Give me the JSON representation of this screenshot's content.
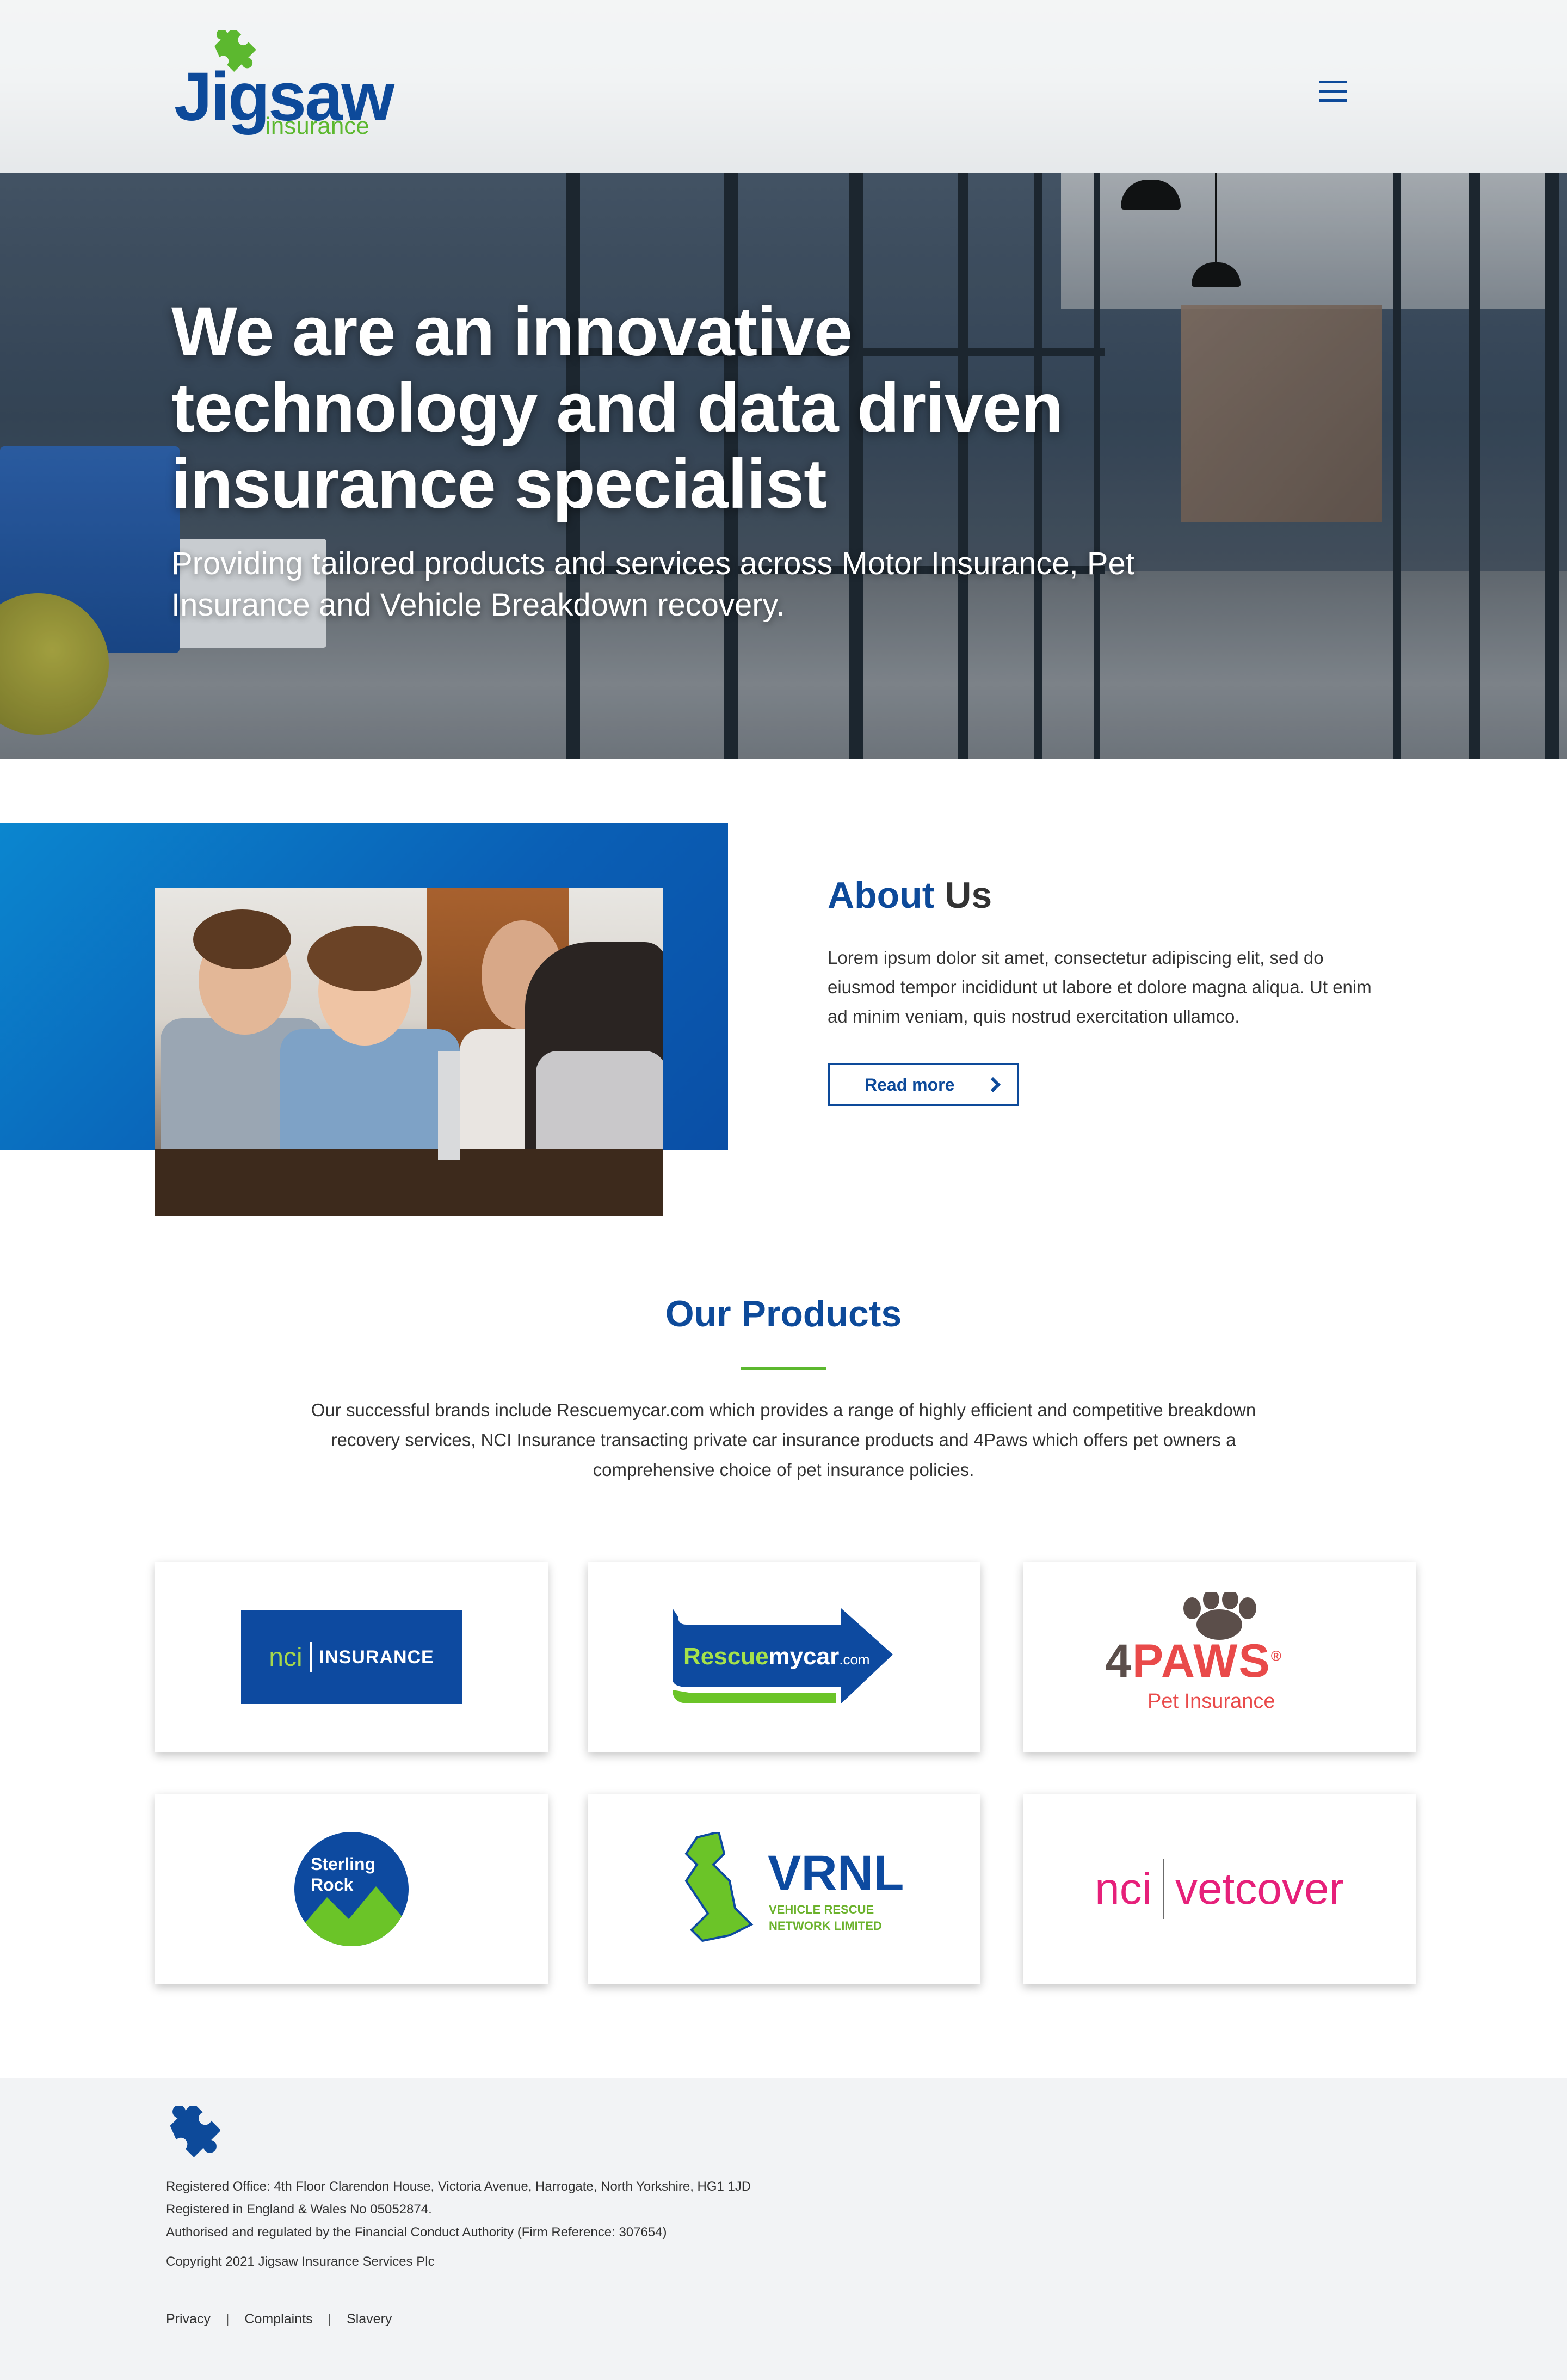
{
  "header": {
    "logo_word": "Jigsaw",
    "logo_sub": "insurance"
  },
  "hero": {
    "title": "We are an innovative technology and data driven insurance specialist",
    "subtitle": "Providing tailored products and services across Motor Insurance, Pet Insurance and Vehicle Breakdown recovery."
  },
  "about": {
    "title_highlight": "About",
    "title_rest": " Us",
    "body": "Lorem ipsum dolor sit amet, consectetur adipiscing elit, sed do eiusmod tempor incididunt ut labore et dolore magna aliqua. Ut enim ad minim veniam, quis nostrud exercitation ullamco.",
    "button_label": "Read more"
  },
  "products": {
    "title": "Our Products",
    "body": "Our successful brands include Rescuemycar.com which provides a range of highly efficient and competitive breakdown recovery services, NCI Insurance transacting private car insurance products and 4Paws which offers pet owners a comprehensive choice of pet insurance policies.",
    "brands": {
      "nci": {
        "mark": "nci",
        "text": "INSURANCE"
      },
      "rescue": {
        "part1": "Rescue",
        "part2": "mycar",
        "part3": ".com"
      },
      "paws": {
        "four": "4",
        "word": "PAWS",
        "reg": "®",
        "sub": "Pet Insurance"
      },
      "sterling": {
        "line1": "Sterling",
        "line2": "Rock"
      },
      "vrnl": {
        "big": "VRNL",
        "line1": "VEHICLE RESCUE",
        "line2": "NETWORK LIMITED"
      },
      "vetcover": {
        "nci": "nci",
        "v": "v",
        "rest": "etcover"
      }
    }
  },
  "footer": {
    "address": "Registered Office: 4th Floor Clarendon House, Victoria Avenue, Harrogate, North Yorkshire, HG1 1JD",
    "registered": "Registered in England & Wales No 05052874.",
    "regulated": "Authorised and regulated by the Financial Conduct Authority (Firm Reference: 307654)",
    "copyright": "Copyright 2021 Jigsaw Insurance Services Plc",
    "links": [
      "Privacy",
      "Complaints",
      "Slavery"
    ],
    "separator": "|"
  },
  "colors": {
    "brand_blue": "#0d4a9a",
    "brand_green": "#5cb82f",
    "footer_bg": "#f2f3f5"
  },
  "icons": {
    "logo_mark": "puzzle-piece-icon",
    "menu": "hamburger-menu-icon",
    "read_more": "chevron-right-icon"
  }
}
